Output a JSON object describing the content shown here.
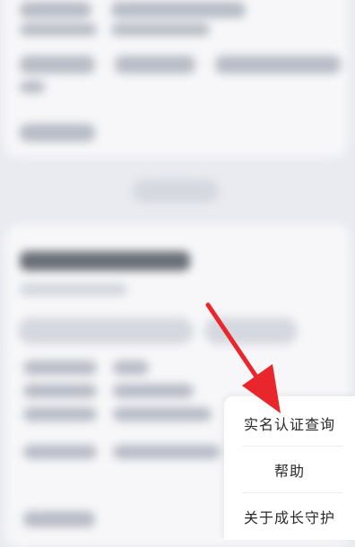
{
  "popup_menu": {
    "items": [
      {
        "label": "实名认证查询"
      },
      {
        "label": "帮助"
      },
      {
        "label": "关于成长守护"
      }
    ]
  },
  "annotation": {
    "arrow_color": "#e8262b"
  },
  "colors": {
    "background": "#e9ebf1",
    "card": "#f7f7f9",
    "menu_bg": "#ffffff",
    "menu_text": "#2a2a2a"
  }
}
